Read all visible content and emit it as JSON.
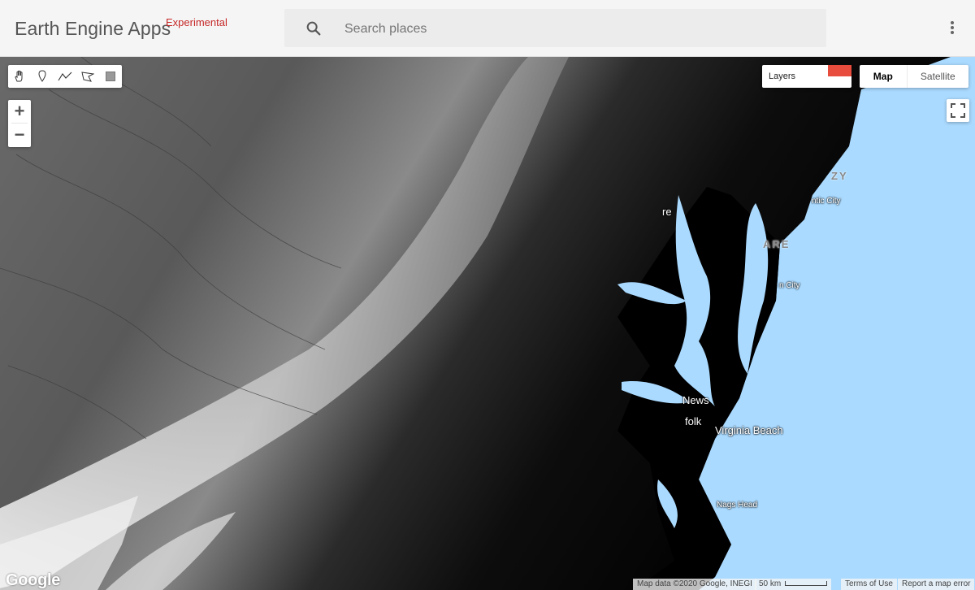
{
  "header": {
    "app_title": "Earth Engine Apps",
    "badge": "Experimental",
    "search_placeholder": "Search places",
    "menu_icon": "more-vert-icon"
  },
  "toolbar": {
    "tools": [
      "pan-hand-icon",
      "point-marker-icon",
      "line-icon",
      "polygon-icon",
      "rectangle-icon"
    ]
  },
  "zoom": {
    "in": "+",
    "out": "−"
  },
  "layers": {
    "label": "Layers",
    "swatch_color": "#e74c3c"
  },
  "map_type": {
    "map": "Map",
    "satellite": "Satellite",
    "selected": "Map"
  },
  "places": {
    "ny_fragment": "ZY",
    "atlantic_city": "ntic City",
    "dover_fragment": "ARE",
    "baltimore_fragment": "re",
    "ocean_city": "n City",
    "newport_news": "News",
    "norfolk": "folk",
    "virginia_beach": "Virginia Beach",
    "nags_head": "Nags Head"
  },
  "footer": {
    "logo": "Google",
    "map_data": "Map data ©2020 Google, INEGI",
    "scale": "50 km",
    "terms": "Terms of Use",
    "report": "Report a map error"
  },
  "colors": {
    "ocean": "#aadaff",
    "header_bg": "#f5f5f5",
    "experimental": "#c62828"
  }
}
